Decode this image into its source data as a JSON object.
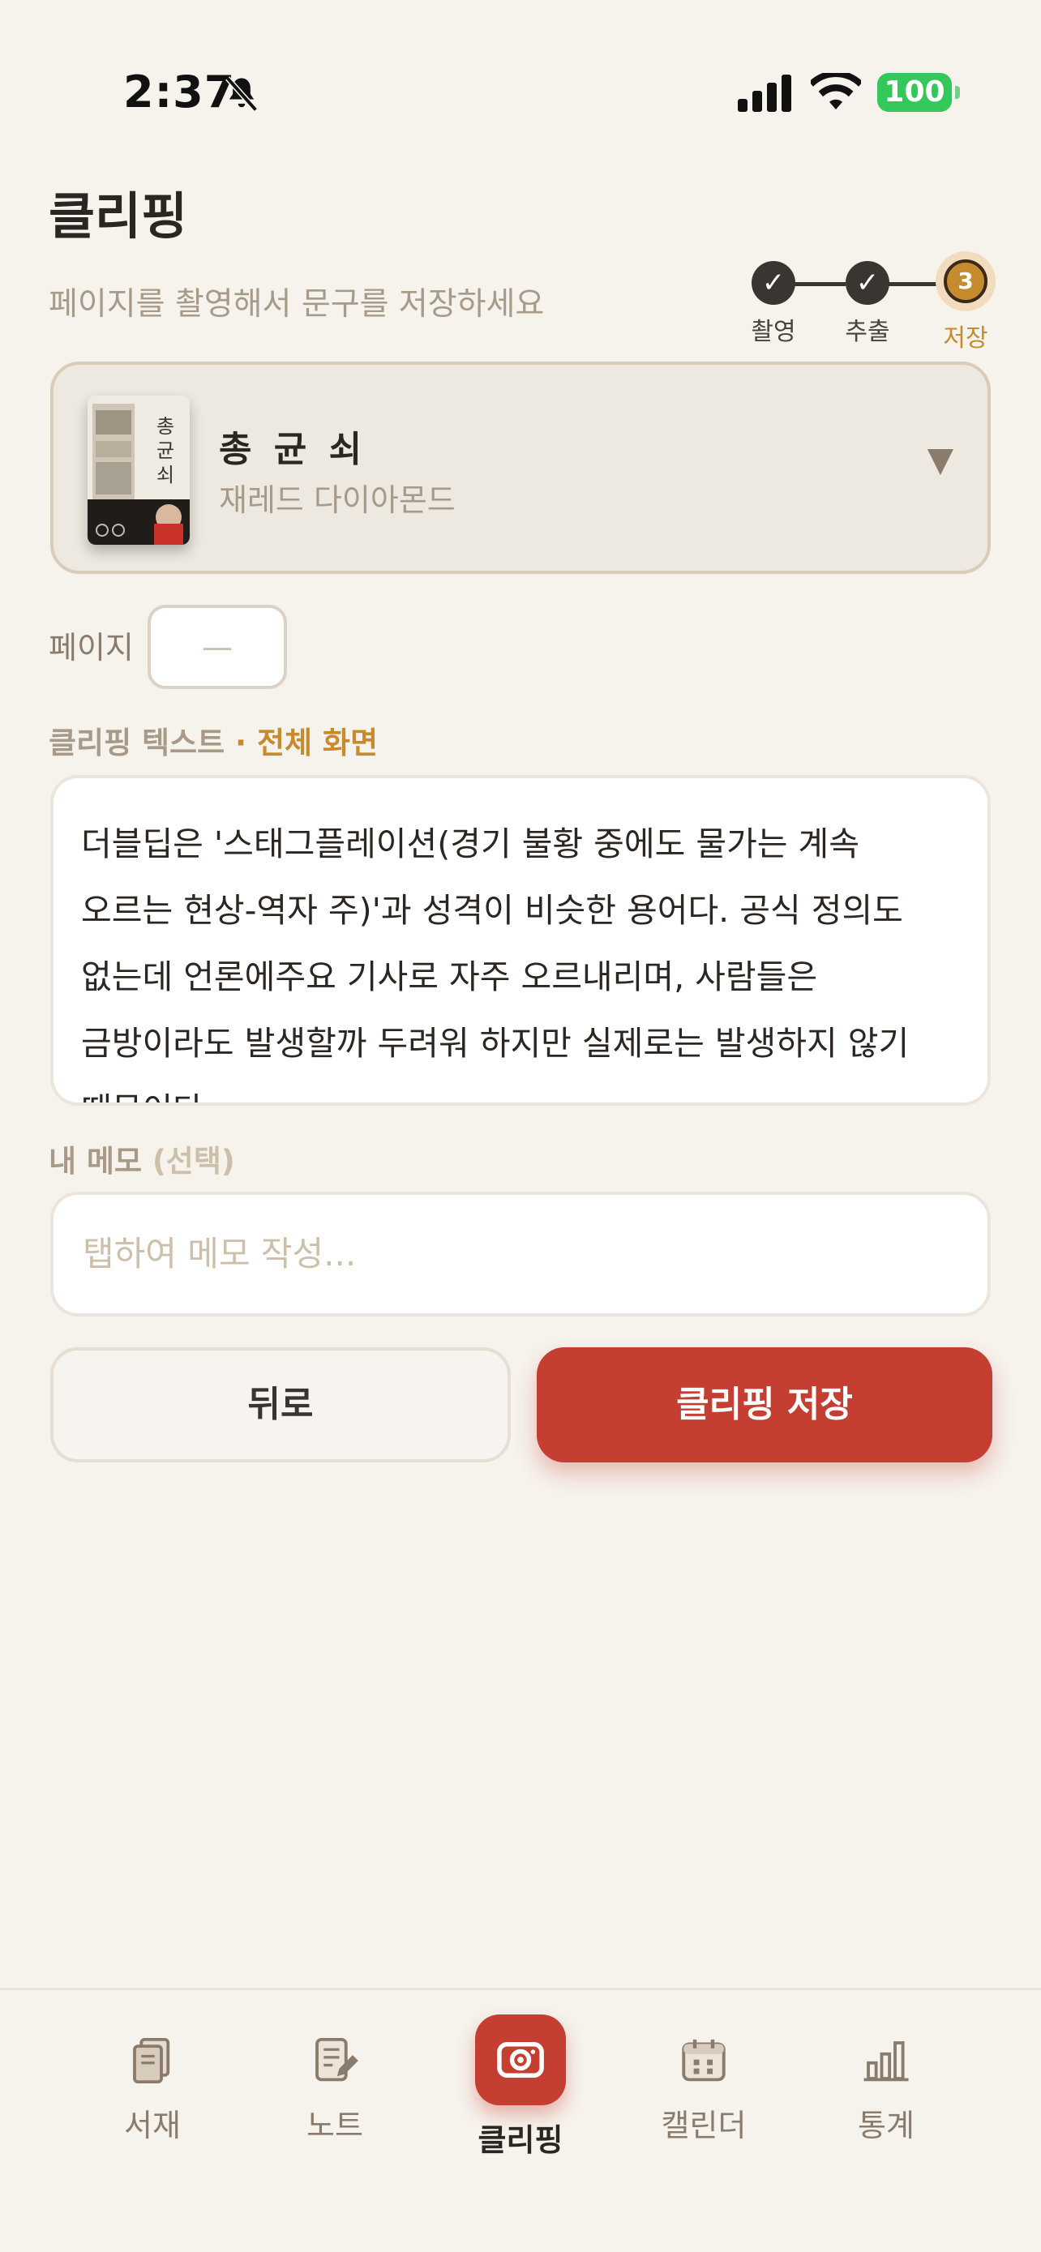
{
  "status": {
    "time": "2:37",
    "battery": "100"
  },
  "header": {
    "title": "클리핑",
    "subtitle": "페이지를 촬영해서 문구를 저장하세요"
  },
  "stepper": {
    "steps": [
      {
        "label": "촬영",
        "mark": "✓",
        "state": "done"
      },
      {
        "label": "추출",
        "mark": "✓",
        "state": "done"
      },
      {
        "label": "저장",
        "mark": "3",
        "state": "active"
      }
    ]
  },
  "book": {
    "title": "총 균 쇠",
    "author": "재레드 다이아몬드",
    "cover_text": "총균쇠",
    "dropdown_icon": "▼"
  },
  "page": {
    "label": "페이지",
    "value": "—"
  },
  "clip": {
    "label": "클리핑 텍스트",
    "mode": " · 전체 화면",
    "text": "더블딥은 '스태그플레이션(경기 불황 중에도 물가는 계속 오르는 현상-역자 주)'과 성격이 비슷한 용어다. 공식 정의도 없는데 언론에주요 기사로 자주 오르내리며, 사람들은 금방이라도 발생할까 두려워 하지만 실제로는 발생하지 않기 때문이다"
  },
  "memo": {
    "label": "내 메모",
    "optional": " (선택)",
    "placeholder": "탭하여 메모 작성..."
  },
  "buttons": {
    "back": "뒤로",
    "save": "클리핑 저장"
  },
  "tabs": [
    {
      "label": "서재",
      "icon": "library-icon"
    },
    {
      "label": "노트",
      "icon": "note-edit-icon"
    },
    {
      "label": "클리핑",
      "icon": "camera-icon",
      "active": true
    },
    {
      "label": "캘린더",
      "icon": "calendar-icon"
    },
    {
      "label": "통계",
      "icon": "bar-chart-icon"
    }
  ],
  "colors": {
    "accent": "#c68b2e",
    "primary": "#c43e31",
    "background": "#f6f2ec"
  }
}
